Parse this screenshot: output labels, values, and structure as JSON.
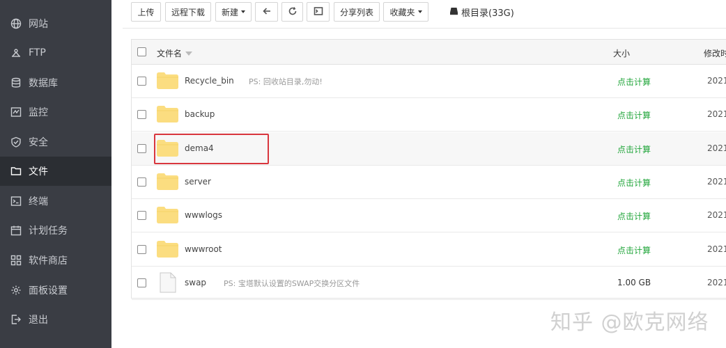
{
  "sidebar": {
    "items": [
      {
        "label": "网站",
        "icon": "globe-icon"
      },
      {
        "label": "FTP",
        "icon": "ftp-icon"
      },
      {
        "label": "数据库",
        "icon": "database-icon"
      },
      {
        "label": "监控",
        "icon": "monitor-icon"
      },
      {
        "label": "安全",
        "icon": "shield-icon"
      },
      {
        "label": "文件",
        "icon": "folder-icon",
        "active": true
      },
      {
        "label": "终端",
        "icon": "terminal-icon"
      },
      {
        "label": "计划任务",
        "icon": "calendar-icon"
      },
      {
        "label": "软件商店",
        "icon": "grid-icon"
      },
      {
        "label": "面板设置",
        "icon": "gear-icon"
      },
      {
        "label": "退出",
        "icon": "logout-icon"
      }
    ]
  },
  "toolbar": {
    "upload": "上传",
    "remote_download": "远程下载",
    "new": "新建",
    "share_list": "分享列表",
    "favorites": "收藏夹",
    "disk_label": "根目录(33G)"
  },
  "table": {
    "headers": {
      "name": "文件名",
      "size": "大小",
      "modified": "修改时"
    },
    "rows": [
      {
        "name": "Recycle_bin",
        "note": "PS: 回收站目录,勿动!",
        "size": "点击计算",
        "date": "2021",
        "type": "folder"
      },
      {
        "name": "backup",
        "note": "",
        "size": "点击计算",
        "date": "2021",
        "type": "folder"
      },
      {
        "name": "dema4",
        "note": "",
        "size": "点击计算",
        "date": "2021",
        "type": "folder",
        "highlighted": true
      },
      {
        "name": "server",
        "note": "",
        "size": "点击计算",
        "date": "2021",
        "type": "folder"
      },
      {
        "name": "wwwlogs",
        "note": "",
        "size": "点击计算",
        "date": "2021",
        "type": "folder"
      },
      {
        "name": "wwwroot",
        "note": "",
        "size": "点击计算",
        "date": "2021",
        "type": "folder"
      },
      {
        "name": "swap",
        "note": "PS: 宝塔默认设置的SWAP交换分区文件",
        "size": "1.00 GB",
        "date": "2021",
        "type": "file"
      }
    ]
  },
  "colors": {
    "sidebar_bg": "#3a3d44",
    "sidebar_active": "#2b2e33",
    "calc_green": "#20a53a",
    "highlight_red": "#d9363e",
    "folder_yellow": "#fbdd80"
  },
  "watermark": "知乎 @欧克网络"
}
